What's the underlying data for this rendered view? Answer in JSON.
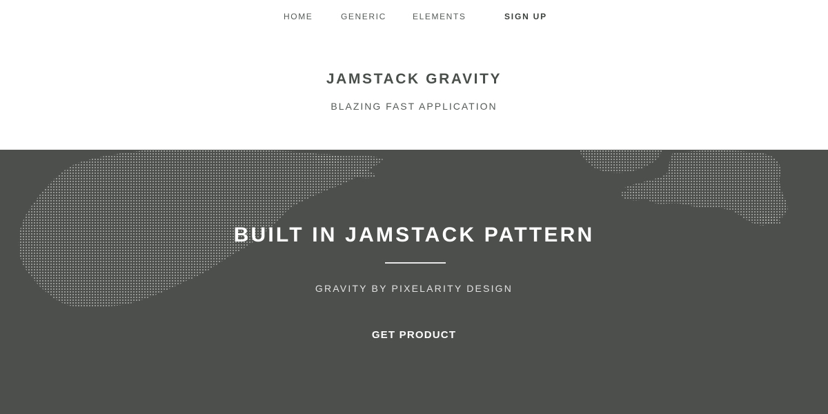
{
  "nav": {
    "items": [
      {
        "label": "HOME"
      },
      {
        "label": "GENERIC"
      },
      {
        "label": "ELEMENTS"
      }
    ],
    "signup_label": "SIGN UP"
  },
  "header": {
    "title": "JAMSTACK GRAVITY",
    "tagline": "BLAZING FAST APPLICATION"
  },
  "hero": {
    "heading": "BUILT IN JAMSTACK PATTERN",
    "subheading": "GRAVITY BY PIXELARITY DESIGN",
    "button_label": "GET PRODUCT",
    "background_color": "#4c4f4c",
    "map_dot_color": "#c9cbc8"
  }
}
